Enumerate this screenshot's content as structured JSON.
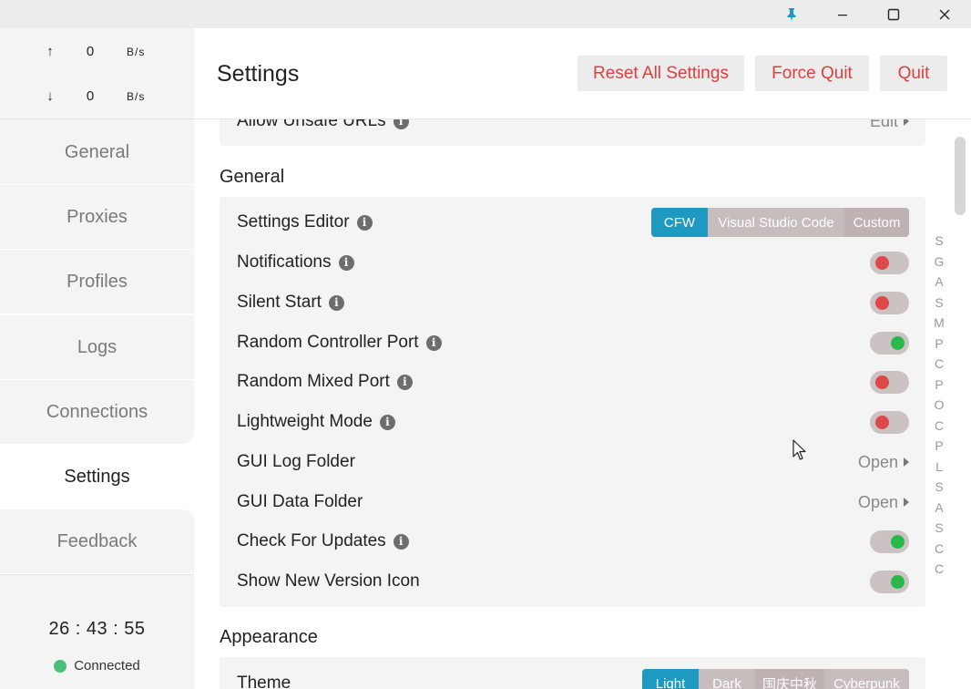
{
  "titlebar": {
    "pin_icon": "pin-icon",
    "minimize_icon": "minimize-icon",
    "maximize_icon": "maximize-icon",
    "close_icon": "close-icon"
  },
  "traffic": {
    "up": {
      "arrow": "↑",
      "value": "0",
      "unit": "B/s"
    },
    "down": {
      "arrow": "↓",
      "value": "0",
      "unit": "B/s"
    }
  },
  "sidebar": {
    "items": [
      {
        "label": "General"
      },
      {
        "label": "Proxies"
      },
      {
        "label": "Profiles"
      },
      {
        "label": "Logs"
      },
      {
        "label": "Connections"
      },
      {
        "label": "Settings"
      },
      {
        "label": "Feedback"
      }
    ],
    "active": "Settings"
  },
  "footer": {
    "clock": "26 : 43 : 55",
    "status": "Connected",
    "status_color": "#4bc07d"
  },
  "header": {
    "title": "Settings",
    "reset_label": "Reset All Settings",
    "force_quit_label": "Force Quit",
    "quit_label": "Quit",
    "button_text_color": "#e03e3e"
  },
  "top_card": {
    "label": "Allow Unsafe URLs",
    "action": "Edit"
  },
  "general": {
    "title": "General",
    "settings_editor": {
      "label": "Settings Editor",
      "options": [
        "CFW",
        "Visual Studio Code",
        "Custom"
      ],
      "selected": "CFW"
    },
    "rows": [
      {
        "label": "Notifications",
        "info": true,
        "type": "toggle",
        "on": false
      },
      {
        "label": "Silent Start",
        "info": true,
        "type": "toggle",
        "on": false
      },
      {
        "label": "Random Controller Port",
        "info": true,
        "type": "toggle",
        "on": true
      },
      {
        "label": "Random Mixed Port",
        "info": true,
        "type": "toggle",
        "on": false
      },
      {
        "label": "Lightweight Mode",
        "info": true,
        "type": "toggle",
        "on": false
      },
      {
        "label": "GUI Log Folder",
        "info": false,
        "type": "link",
        "action": "Open"
      },
      {
        "label": "GUI Data Folder",
        "info": false,
        "type": "link",
        "action": "Open"
      },
      {
        "label": "Check For Updates",
        "info": true,
        "type": "toggle",
        "on": true
      },
      {
        "label": "Show New Version Icon",
        "info": false,
        "type": "toggle",
        "on": true
      }
    ]
  },
  "appearance": {
    "title": "Appearance",
    "theme": {
      "label": "Theme",
      "options": [
        "Light",
        "Dark",
        "国庆中秋",
        "Cyberpunk"
      ],
      "selected": "Light"
    }
  },
  "index_letters": [
    "S",
    "G",
    "A",
    "S",
    "M",
    "P",
    "C",
    "P",
    "O",
    "C",
    "P",
    "L",
    "S",
    "A",
    "S",
    "C",
    "C"
  ],
  "colors": {
    "accent": "#1e99c1",
    "toggle_on": "#2bb84a",
    "toggle_off": "#de4848"
  }
}
